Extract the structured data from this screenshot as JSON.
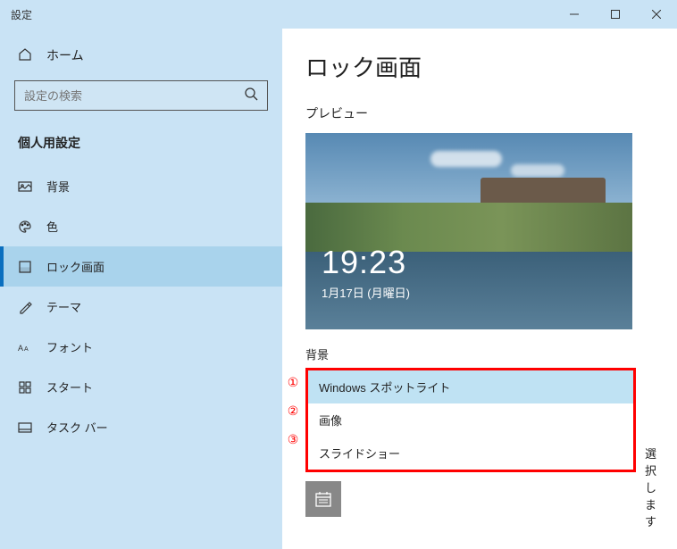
{
  "window": {
    "title": "設定"
  },
  "sidebar": {
    "home_label": "ホーム",
    "search_placeholder": "設定の検索",
    "category": "個人用設定",
    "items": [
      {
        "label": "背景"
      },
      {
        "label": "色"
      },
      {
        "label": "ロック画面"
      },
      {
        "label": "テーマ"
      },
      {
        "label": "フォント"
      },
      {
        "label": "スタート"
      },
      {
        "label": "タスク バー"
      }
    ]
  },
  "main": {
    "title": "ロック画面",
    "preview_label": "プレビュー",
    "preview_time": "19:23",
    "preview_date": "1月17日 (月曜日)",
    "background_label": "背景",
    "dropdown": {
      "options": [
        "Windows スポットライト",
        "画像",
        "スライドショー"
      ]
    },
    "hint_tail": "選択します"
  },
  "annotations": {
    "a1": "①",
    "a2": "②",
    "a3": "③"
  }
}
